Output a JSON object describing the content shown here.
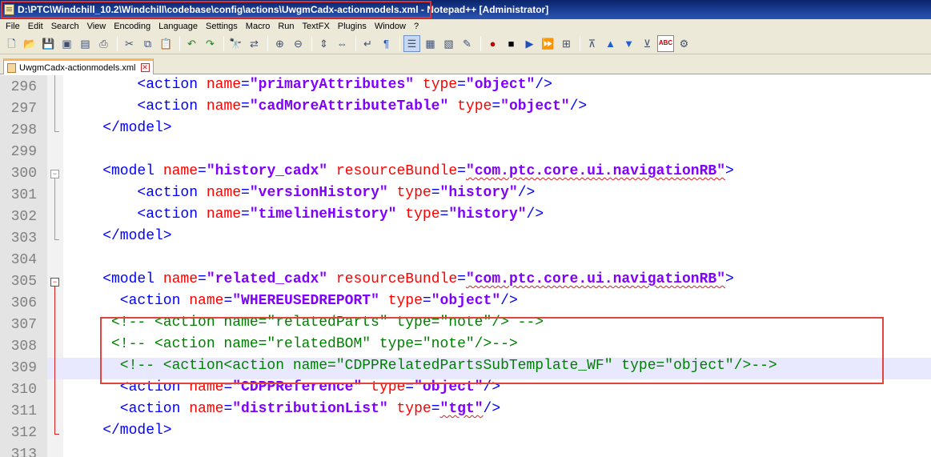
{
  "window": {
    "title": "D:\\PTC\\Windchill_10.2\\Windchill\\codebase\\config\\actions\\UwgmCadx-actionmodels.xml - Notepad++ [Administrator]"
  },
  "menu": [
    "File",
    "Edit",
    "Search",
    "View",
    "Encoding",
    "Language",
    "Settings",
    "Macro",
    "Run",
    "TextFX",
    "Plugins",
    "Window",
    "?"
  ],
  "toolbar": {
    "icons": [
      "new-file-icon",
      "open-file-icon",
      "save-icon",
      "save-all-icon",
      "close-file-icon",
      "print-icon",
      "sep",
      "cut-icon",
      "copy-icon",
      "paste-icon",
      "sep",
      "undo-icon",
      "redo-icon",
      "sep",
      "find-icon",
      "replace-icon",
      "sep",
      "zoom-in-icon",
      "zoom-out-icon",
      "sep",
      "sync-vertical-icon",
      "sync-horizontal-icon",
      "sep",
      "word-wrap-icon",
      "show-all-chars-icon",
      "sep",
      "indent-guide-icon",
      "function-list-icon",
      "doc-map-icon",
      "user-defined-lang-icon",
      "sep",
      "record-macro-icon",
      "stop-macro-icon",
      "play-macro-icon",
      "run-macro-multiple-icon",
      "save-macro-icon",
      "sep",
      "collapse-icon",
      "move-up-icon",
      "move-down-icon",
      "expand-icon",
      "spell-check-icon",
      "plugin-icon"
    ],
    "glyphs": {
      "new-file-icon": "🗋",
      "open-file-icon": "📂",
      "save-icon": "💾",
      "save-all-icon": "▣",
      "close-file-icon": "▤",
      "print-icon": "⎙",
      "cut-icon": "✂",
      "copy-icon": "⧉",
      "paste-icon": "📋",
      "undo-icon": "↶",
      "redo-icon": "↷",
      "find-icon": "🔭",
      "replace-icon": "⇄",
      "zoom-in-icon": "⊕",
      "zoom-out-icon": "⊖",
      "sync-vertical-icon": "⇕",
      "sync-horizontal-icon": "⇔",
      "word-wrap-icon": "↵",
      "show-all-chars-icon": "¶",
      "indent-guide-icon": "☰",
      "function-list-icon": "▦",
      "doc-map-icon": "▧",
      "user-defined-lang-icon": "✎",
      "record-macro-icon": "●",
      "stop-macro-icon": "■",
      "play-macro-icon": "▶",
      "run-macro-multiple-icon": "⏩",
      "save-macro-icon": "⊞",
      "collapse-icon": "⊼",
      "move-up-icon": "▲",
      "move-down-icon": "▼",
      "expand-icon": "⊻",
      "spell-check-icon": "ABC",
      "plugin-icon": "⚙"
    },
    "colors": {
      "record-macro-icon": "#c00000",
      "stop-macro-icon": "#000000",
      "play-macro-icon": "#2050c0",
      "move-up-icon": "#2060d0",
      "move-down-icon": "#2060d0",
      "undo-icon": "#208020",
      "redo-icon": "#208020",
      "spell-check-icon": "#c00000",
      "show-all-chars-icon": "#2050c0"
    },
    "active": [
      "indent-guide-icon"
    ]
  },
  "tab": {
    "label": "UwgmCadx-actionmodels.xml"
  },
  "colors": {
    "tag": "#0000ff",
    "attribute": "#ff0000",
    "value": "#8000ff",
    "comment": "#008000",
    "highlight_box": "#e0443a",
    "title_highlight": "#e03030"
  },
  "editor": {
    "current_line": 309,
    "lines": [
      {
        "n": "296",
        "fold": "",
        "indent": 8,
        "tokens": [
          [
            "t",
            "<action "
          ],
          [
            "a",
            "name"
          ],
          [
            "t",
            "="
          ],
          [
            "v",
            "\"primaryAttributes\""
          ],
          [
            "t",
            " "
          ],
          [
            "a",
            "type"
          ],
          [
            "t",
            "="
          ],
          [
            "v",
            "\"object\""
          ],
          [
            "t",
            "/>"
          ]
        ]
      },
      {
        "n": "297",
        "fold": "",
        "indent": 8,
        "tokens": [
          [
            "t",
            "<action "
          ],
          [
            "a",
            "name"
          ],
          [
            "t",
            "="
          ],
          [
            "v",
            "\"cadMoreAttributeTable\""
          ],
          [
            "t",
            " "
          ],
          [
            "a",
            "type"
          ],
          [
            "t",
            "="
          ],
          [
            "v",
            "\"object\""
          ],
          [
            "t",
            "/>"
          ]
        ]
      },
      {
        "n": "298",
        "fold": "end",
        "indent": 4,
        "tokens": [
          [
            "t",
            "</model>"
          ]
        ]
      },
      {
        "n": "299",
        "fold": "",
        "indent": 0,
        "tokens": []
      },
      {
        "n": "300",
        "fold": "open",
        "indent": 4,
        "tokens": [
          [
            "t",
            "<model "
          ],
          [
            "a",
            "name"
          ],
          [
            "t",
            "="
          ],
          [
            "v",
            "\"history_cadx\""
          ],
          [
            "t",
            " "
          ],
          [
            "a",
            "resourceBundle"
          ],
          [
            "t",
            "="
          ],
          [
            "vs",
            "\"com.ptc.core.ui.navigationRB\""
          ],
          [
            "t",
            ">"
          ]
        ]
      },
      {
        "n": "301",
        "fold": "",
        "indent": 8,
        "tokens": [
          [
            "t",
            "<action "
          ],
          [
            "a",
            "name"
          ],
          [
            "t",
            "="
          ],
          [
            "v",
            "\"versionHistory\""
          ],
          [
            "t",
            " "
          ],
          [
            "a",
            "type"
          ],
          [
            "t",
            "="
          ],
          [
            "v",
            "\"history\""
          ],
          [
            "t",
            "/>"
          ]
        ]
      },
      {
        "n": "302",
        "fold": "",
        "indent": 8,
        "tokens": [
          [
            "t",
            "<action "
          ],
          [
            "a",
            "name"
          ],
          [
            "t",
            "="
          ],
          [
            "v",
            "\"timelineHistory\""
          ],
          [
            "t",
            " "
          ],
          [
            "a",
            "type"
          ],
          [
            "t",
            "="
          ],
          [
            "v",
            "\"history\""
          ],
          [
            "t",
            "/>"
          ]
        ]
      },
      {
        "n": "303",
        "fold": "end",
        "indent": 4,
        "tokens": [
          [
            "t",
            "</model>"
          ]
        ]
      },
      {
        "n": "304",
        "fold": "",
        "indent": 0,
        "tokens": []
      },
      {
        "n": "305",
        "fold": "open-red",
        "indent": 4,
        "tokens": [
          [
            "t",
            "<model "
          ],
          [
            "a",
            "name"
          ],
          [
            "t",
            "="
          ],
          [
            "v",
            "\"related_cadx\""
          ],
          [
            "t",
            " "
          ],
          [
            "a",
            "resourceBundle"
          ],
          [
            "t",
            "="
          ],
          [
            "vs",
            "\"com.ptc.core.ui.navigationRB\""
          ],
          [
            "t",
            ">"
          ]
        ]
      },
      {
        "n": "306",
        "fold": "",
        "indent": 6,
        "tokens": [
          [
            "t",
            "<action "
          ],
          [
            "a",
            "name"
          ],
          [
            "t",
            "="
          ],
          [
            "v",
            "\"WHEREUSEDREPORT\""
          ],
          [
            "t",
            " "
          ],
          [
            "a",
            "type"
          ],
          [
            "t",
            "="
          ],
          [
            "v",
            "\"object\""
          ],
          [
            "t",
            "/>"
          ]
        ]
      },
      {
        "n": "307",
        "fold": "",
        "indent": 5,
        "tokens": [
          [
            "c",
            "<!-- <action name=\"relatedParts\" type=\"note\"/> -->"
          ]
        ]
      },
      {
        "n": "308",
        "fold": "",
        "indent": 5,
        "tokens": [
          [
            "c",
            "<!-- <action name=\"relatedBOM\" type=\"note\"/>-->"
          ]
        ]
      },
      {
        "n": "309",
        "fold": "",
        "indent": 6,
        "tokens": [
          [
            "c",
            "<!-- <action<action name=\"CDPPRelatedPartsSubTemplate_WF\" type=\"object\"/>-->"
          ]
        ]
      },
      {
        "n": "310",
        "fold": "",
        "indent": 6,
        "tokens": [
          [
            "t",
            "<action "
          ],
          [
            "a",
            "name"
          ],
          [
            "t",
            "="
          ],
          [
            "v",
            "\"CDPPReference\""
          ],
          [
            "t",
            " "
          ],
          [
            "a",
            "type"
          ],
          [
            "t",
            "="
          ],
          [
            "v",
            "\"object\""
          ],
          [
            "t",
            "/>"
          ]
        ]
      },
      {
        "n": "311",
        "fold": "",
        "indent": 6,
        "tokens": [
          [
            "t",
            "<action "
          ],
          [
            "a",
            "name"
          ],
          [
            "t",
            "="
          ],
          [
            "v",
            "\"distributionList\""
          ],
          [
            "t",
            " "
          ],
          [
            "a",
            "type"
          ],
          [
            "t",
            "="
          ],
          [
            "vs",
            "\"tgt\""
          ],
          [
            "t",
            "/>"
          ]
        ]
      },
      {
        "n": "312",
        "fold": "end-red",
        "indent": 4,
        "tokens": [
          [
            "t",
            "</model>"
          ]
        ]
      },
      {
        "n": "313",
        "fold": "",
        "indent": 0,
        "tokens": []
      }
    ]
  }
}
